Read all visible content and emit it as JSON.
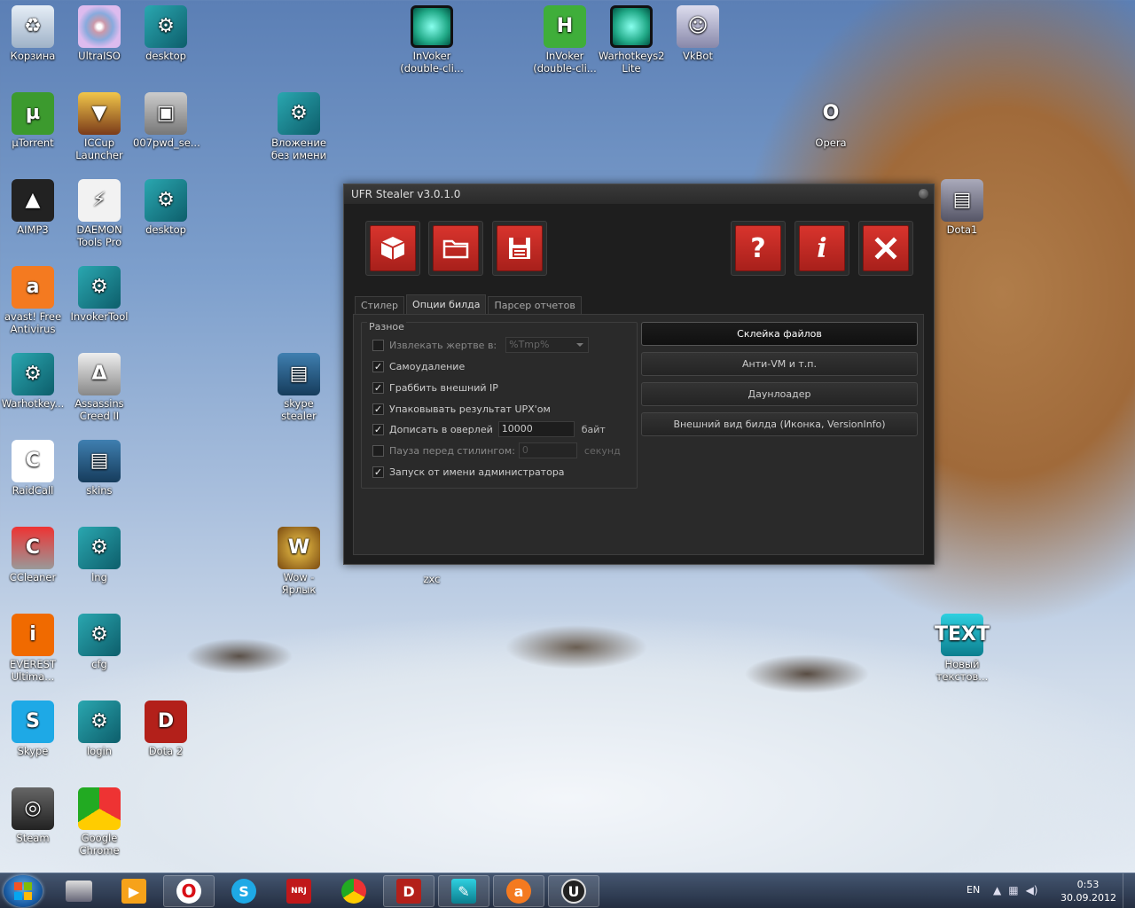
{
  "desktop": {
    "icons": [
      {
        "label": "Корзина"
      },
      {
        "label": "UltraISO"
      },
      {
        "label": "desktop"
      },
      {
        "label": "µTorrent"
      },
      {
        "label": "ICCup Launcher"
      },
      {
        "label": "007pwd_se..."
      },
      {
        "label": "AIMP3"
      },
      {
        "label": "DAEMON Tools Pro"
      },
      {
        "label": "desktop"
      },
      {
        "label": "avast! Free Antivirus"
      },
      {
        "label": "InvokerTool"
      },
      {
        "label": "Warhotkey..."
      },
      {
        "label": "Assassins Creed II"
      },
      {
        "label": "RaidCall"
      },
      {
        "label": "skins"
      },
      {
        "label": "CCleaner"
      },
      {
        "label": "lng"
      },
      {
        "label": "EVEREST Ultima..."
      },
      {
        "label": "cfg"
      },
      {
        "label": "Skype"
      },
      {
        "label": "login"
      },
      {
        "label": "Dota 2"
      },
      {
        "label": "Steam"
      },
      {
        "label": "Google Chrome"
      },
      {
        "label": "Вложение без имени"
      },
      {
        "label": "skype stealer"
      },
      {
        "label": "Wow - Ярлык"
      },
      {
        "label": "zxc"
      },
      {
        "label": "InVoker (double-cli..."
      },
      {
        "label": "InVoker (double-cli..."
      },
      {
        "label": "Warhotkeys2 Lite"
      },
      {
        "label": "VkBot"
      },
      {
        "label": "Opera"
      },
      {
        "label": "Dota1"
      },
      {
        "label": "Новый текстов..."
      }
    ]
  },
  "window": {
    "title": "UFR Stealer v3.0.1.0",
    "toolbar": {
      "help_glyph": "?",
      "info_glyph": "i"
    },
    "tabs": [
      {
        "label": "Стилер"
      },
      {
        "label": "Опции билда"
      },
      {
        "label": "Парсер отчетов"
      }
    ],
    "group": {
      "title": "Разное",
      "extract_label": "Извлекать жертве в:",
      "extract_value": "%Tmp%",
      "selfdelete_label": "Самоудаление",
      "grab_ip_label": "Граббить внешний IP",
      "upx_label": "Упаковывать результат UPX'ом",
      "overlay_label": "Дописать в оверлей",
      "overlay_value": "10000",
      "overlay_unit": "байт",
      "pause_label": "Пауза перед стилингом:",
      "pause_value": "0",
      "pause_unit": "секунд",
      "admin_label": "Запуск от имени администратора"
    },
    "buttons": {
      "bind_files": "Склейка файлов",
      "anti_vm": "Анти-VM и т.п.",
      "downloader": "Даунлоадер",
      "appearance": "Внешний вид билда (Иконка, VersionInfo)"
    }
  },
  "taskbar": {
    "language": "EN",
    "time": "0:53",
    "date": "30.09.2012",
    "dota_glyph": "D",
    "radio_glyph": "NRJ"
  }
}
